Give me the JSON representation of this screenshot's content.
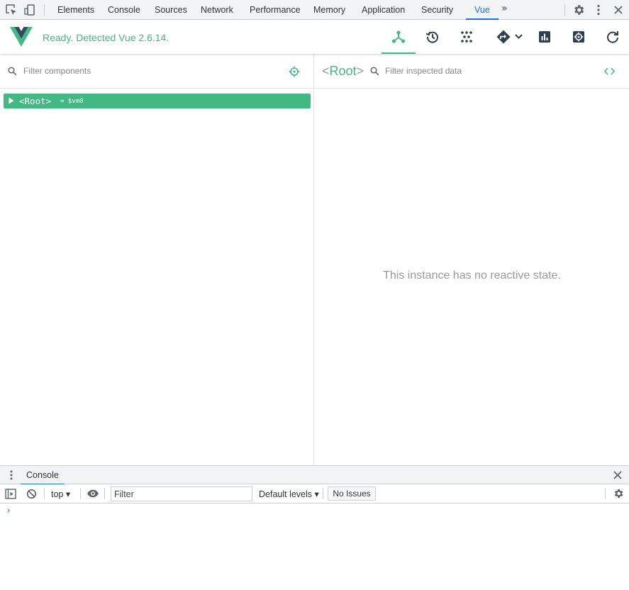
{
  "devtools": {
    "tabs": [
      {
        "label": "Elements"
      },
      {
        "label": "Console"
      },
      {
        "label": "Sources"
      },
      {
        "label": "Network"
      },
      {
        "label": "Performance"
      },
      {
        "label": "Memory"
      },
      {
        "label": "Application"
      },
      {
        "label": "Security"
      },
      {
        "label": "Vue",
        "active": true
      }
    ],
    "more_tabs_glyph": "»",
    "accent_color": "#1a73e8",
    "icons": [
      "inspect-element-icon",
      "device-toolbar-icon",
      "more-tabs-icon",
      "settings-gear-icon",
      "kebab-menu-icon",
      "close-icon"
    ]
  },
  "vue": {
    "status": "Ready. Detected Vue 2.6.14.",
    "brand_color": "#42b983",
    "toolbar": [
      {
        "name": "components-icon",
        "active": true
      },
      {
        "name": "history-icon",
        "active": false
      },
      {
        "name": "vuex-icon",
        "active": false
      },
      {
        "name": "events-icon",
        "active": false
      },
      {
        "name": "performance-icon",
        "active": false
      },
      {
        "name": "settings-icon",
        "active": false
      },
      {
        "name": "refresh-icon",
        "active": false
      }
    ]
  },
  "components_pane": {
    "filter_placeholder": "Filter components",
    "tree": [
      {
        "name": "<Root>",
        "ref": "= $vm0",
        "selected": true,
        "collapsed": true
      }
    ]
  },
  "inspector_pane": {
    "title_open": "<",
    "title": "Root",
    "title_close": ">",
    "filter_placeholder": "Filter inspected data",
    "empty_message": "This instance has no reactive state."
  },
  "drawer": {
    "tab": "Console",
    "context": "top",
    "filter_placeholder": "Filter",
    "levels": "Default levels",
    "issues": "No Issues",
    "prompt": "›"
  }
}
